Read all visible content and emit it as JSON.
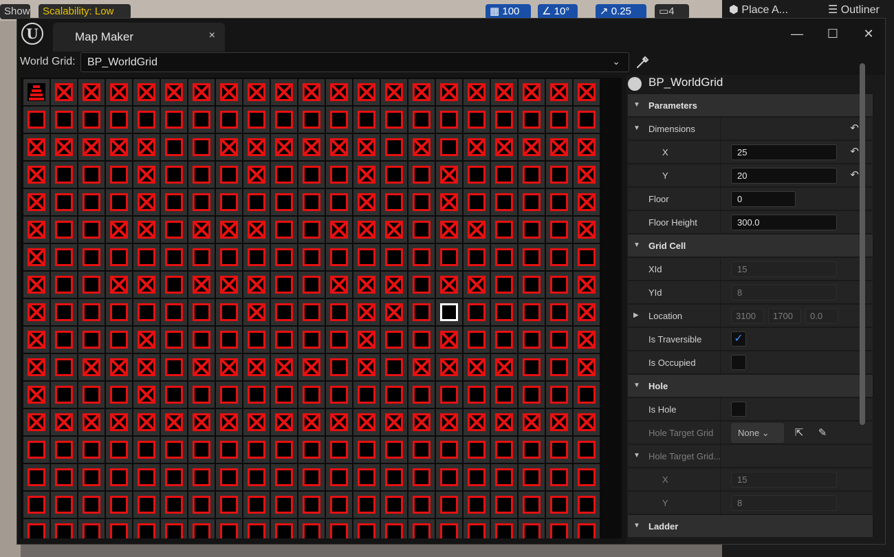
{
  "background": {
    "toolbar_left": "Show",
    "scalability": "Scalability: Low",
    "grid_snap": "100",
    "rotation_snap": "10°",
    "scale_snap": "0.25",
    "camera_speed": "4",
    "place_actors": "Place A...",
    "outliner": "Outliner"
  },
  "window": {
    "tab_title": "Map Maker",
    "tab_close": "×",
    "minimize": "—",
    "maximize": "☐",
    "close": "✕"
  },
  "world_grid": {
    "label": "World Grid:",
    "value": "BP_WorldGrid"
  },
  "grid": {
    "columns": 21,
    "rows": 17,
    "selected": [
      15,
      8
    ],
    "colors": {
      "cell": "#2f2f2f",
      "border": "#e81010",
      "cross": "#e81010",
      "selected": "#ffffff"
    },
    "crossed_rows": [
      "0111111111111111111111",
      "000000000000000000000",
      "111110011111101011111",
      "100010001000100100001",
      "100010000000100100001",
      "100110111001110110001",
      "100000000000000000000",
      "100110111001110110001",
      "100000001000110100001",
      "100010000000100100001",
      "101110111110101111001",
      "100010000000000000000",
      "111111111111111111111",
      "000000000000000000000",
      "000000000000000000000",
      "000000000000000000000",
      "000000000000000000000"
    ]
  },
  "details": {
    "title": "BP_WorldGrid",
    "sections": {
      "parameters": "Parameters",
      "dimensions": "Dimensions",
      "dim_x_label": "X",
      "dim_x": "25",
      "dim_y_label": "Y",
      "dim_y": "20",
      "floor_label": "Floor",
      "floor": "0",
      "floor_height_label": "Floor Height",
      "floor_height": "300.0",
      "grid_cell": "Grid Cell",
      "xid_label": "XId",
      "xid": "15",
      "yid_label": "YId",
      "yid": "8",
      "location_label": "Location",
      "loc_x": "3100",
      "loc_y": "1700",
      "loc_z": "0.0",
      "traversible_label": "Is Traversible",
      "occupied_label": "Is Occupied",
      "hole": "Hole",
      "is_hole_label": "Is Hole",
      "hole_target_label": "Hole Target Grid",
      "hole_target_value": "None",
      "hole_target_grid_label": "Hole Target Grid...",
      "htg_x_label": "X",
      "htg_x": "15",
      "htg_y_label": "Y",
      "htg_y": "8",
      "ladder": "Ladder"
    }
  }
}
